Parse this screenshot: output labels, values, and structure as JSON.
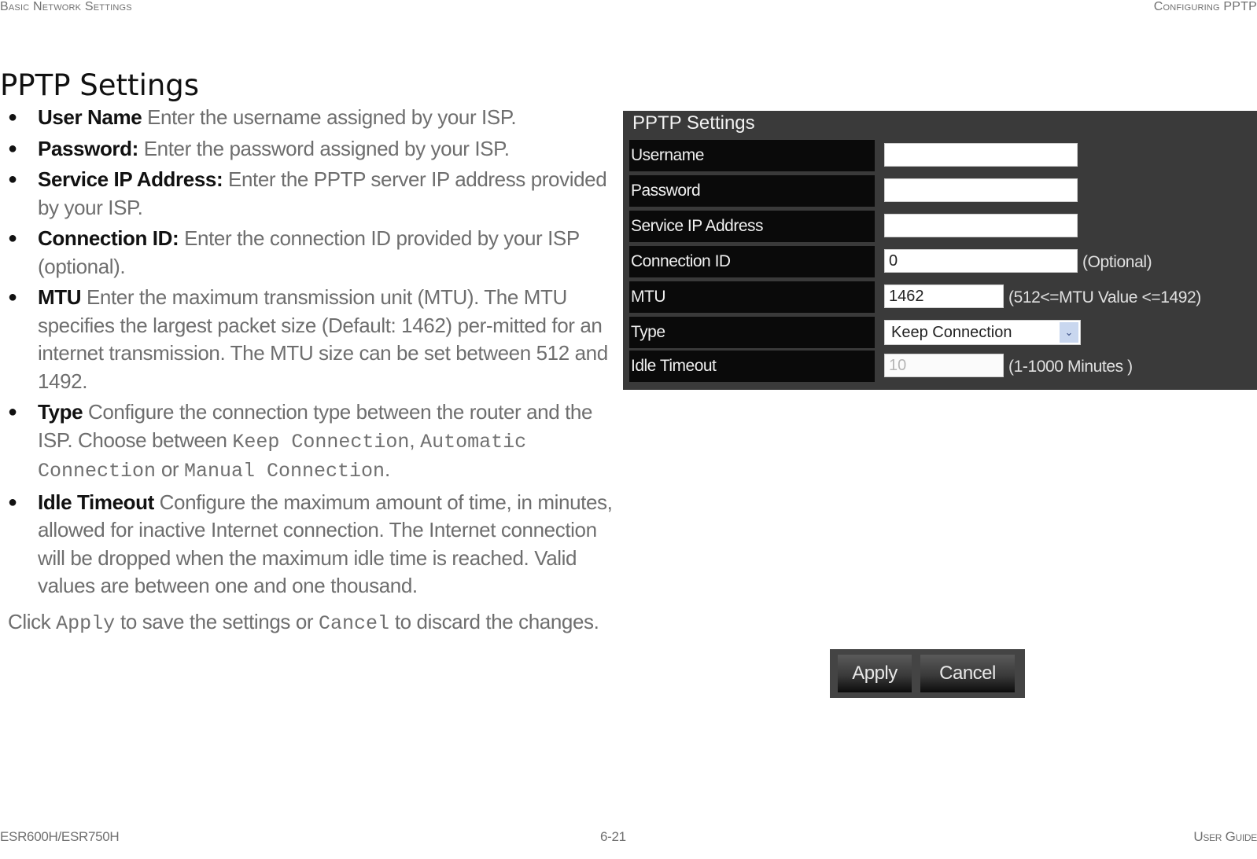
{
  "header": {
    "left": "Basic Network Settings",
    "right": "Configuring PPTP"
  },
  "page_title": "PPTP Settings",
  "items": [
    {
      "term": "User Name",
      "desc": "  Enter the username assigned by your ISP."
    },
    {
      "term": "Password:",
      "desc": " Enter the password assigned by your ISP."
    },
    {
      "term": "Service IP Address:",
      "desc": " Enter the PPTP server IP address provided by your ISP."
    },
    {
      "term": "Connection ID:",
      "desc": " Enter the connection ID provided by your ISP (optional)."
    },
    {
      "term": "MTU",
      "desc": "  Enter the maximum transmission unit (MTU). The MTU specifies the largest packet size (Default: 1462) per-mitted for an internet transmission. The MTU size can be set between 512 and 1492."
    },
    {
      "term": "Type",
      "desc_pre": "  Configure the connection type between the router and the ISP. Choose between ",
      "opt1": "Keep Connection",
      "sep1": ", ",
      "opt2": "Automatic Connection",
      "sep2": " or ",
      "opt3": "Manual Connection",
      "end": "."
    },
    {
      "term": "Idle Timeout",
      "desc": "  Configure the maximum amount of time, in minutes, allowed for inactive Internet connection. The Internet connection will be dropped when the maximum idle time is reached. Valid values are between one and one thousand."
    }
  ],
  "closing": {
    "pre": "Click ",
    "apply": "Apply",
    "mid": " to save the settings or ",
    "cancel": "Cancel",
    "post": " to discard the changes."
  },
  "screenshot": {
    "title": "PPTP Settings",
    "fields": [
      {
        "label": "Username",
        "value": "",
        "hint": ""
      },
      {
        "label": "Password",
        "value": "",
        "hint": ""
      },
      {
        "label": "Service IP Address",
        "value": "",
        "hint": ""
      },
      {
        "label": "Connection ID",
        "value": "0",
        "hint": "(Optional)"
      },
      {
        "label": "MTU",
        "value": "1462",
        "hint": "(512<=MTU Value <=1492)"
      },
      {
        "label": "Type",
        "value": "Keep Connection",
        "hint": ""
      },
      {
        "label": "Idle Timeout",
        "value": "10",
        "hint": "(1-1000 Minutes )"
      }
    ],
    "buttons": {
      "apply": "Apply",
      "cancel": "Cancel"
    }
  },
  "footer": {
    "left": "ESR600H/ESR750H",
    "center": "6-21",
    "right": "User Guide"
  }
}
